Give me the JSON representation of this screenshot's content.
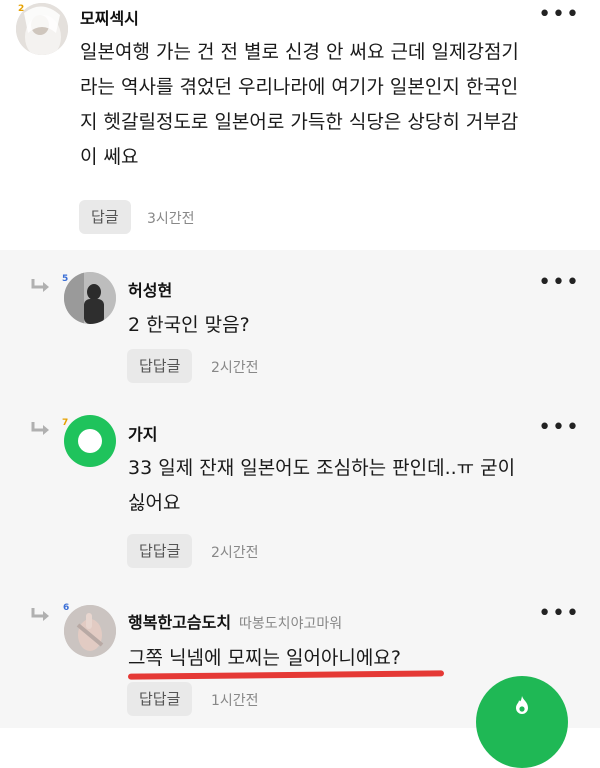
{
  "comments": [
    {
      "author": "모찌섹시",
      "level": "2",
      "text_lines": [
        "일본여행 가는 건 전 별로 신경 안 써요 근데 일제강점기",
        "라는 역사를 겪었던 우리나라에 여기가 일본인지 한국인",
        "지 헷갈릴정도로 일본어로 가득한 식당은 상당히 거부감",
        "이 쎄요"
      ],
      "reply_label": "답글",
      "time": "3시간전",
      "more": "•••"
    },
    {
      "author": "허성현",
      "level": "5",
      "text_lines": [
        "2 한국인 맞음?"
      ],
      "reply_label": "답답글",
      "time": "2시간전",
      "more": "•••"
    },
    {
      "author": "가지",
      "level": "7",
      "text_lines": [
        "33 일제 잔재 일본어도 조심하는 판인데..ㅠ 굳이",
        "싫어요"
      ],
      "reply_label": "답답글",
      "time": "2시간전",
      "more": "•••"
    },
    {
      "author": "행복한고슴도치",
      "author_sub": "따봉도치야고마워",
      "level": "6",
      "text_lines": [
        "그쪽 닉넴에 모찌는 일어아니에요?"
      ],
      "reply_label": "답답글",
      "time": "1시간전",
      "more": "•••"
    }
  ],
  "colors": {
    "accent_green": "#1fb855",
    "highlight_red": "#e53935",
    "reply_bg": "#e9e9e9",
    "thread_bg": "#f6f6f6"
  },
  "icons": {
    "reply_arrow": "reply-arrow-icon",
    "more": "more-dots-icon",
    "fab": "flame-icon"
  }
}
